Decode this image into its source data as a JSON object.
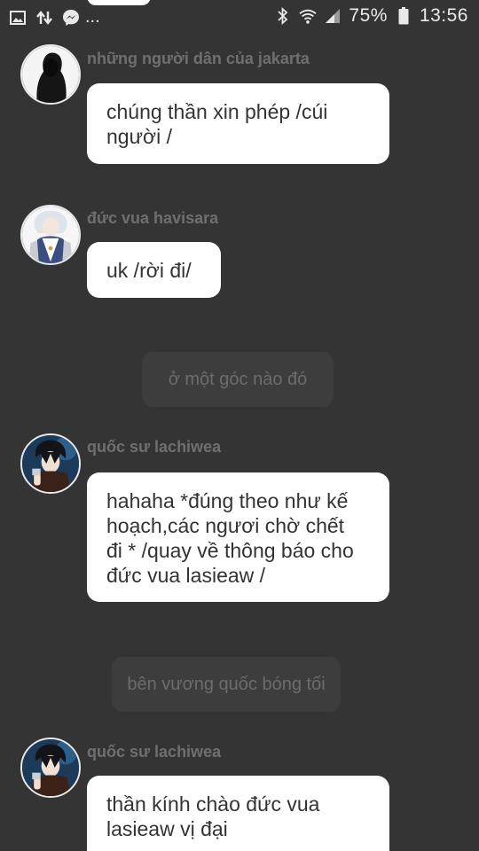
{
  "status_bar": {
    "battery_percent": "75%",
    "time": "13:56",
    "overflow": "...",
    "icons": [
      "gallery-icon",
      "data-transfer-icon",
      "messenger-icon",
      "bluetooth-icon",
      "wifi-icon",
      "signal-icon",
      "battery-icon"
    ]
  },
  "colors": {
    "background": "#343434",
    "bubble": "#ffffff",
    "bubble_text": "#333333",
    "sender_text": "#6f6f6f",
    "narration_bg": "#3d3d3d",
    "narration_text": "#6c6c6c"
  },
  "messages": [
    {
      "sender": "những người dân của jakarta",
      "lines": [
        "chúng thần xin phép /cúi",
        "người /"
      ],
      "avatar": "silhouette-avatar"
    },
    {
      "sender": "đức vua havisara",
      "lines": [
        "uk /rời đi/"
      ],
      "avatar": "king-avatar"
    },
    {
      "sender": "quốc sư lachiwea",
      "lines": [
        "hahaha *đúng theo như kế",
        "hoạch,các ngươi chờ chết",
        "đi * /quay về thông báo cho",
        "đức vua lasieaw /"
      ],
      "avatar": "advisor-avatar"
    },
    {
      "sender": "quốc sư lachiwea",
      "lines": [
        "thần kính chào đức vua",
        "lasieaw vị đại"
      ],
      "avatar": "advisor-avatar"
    }
  ],
  "narrations": [
    "ở một góc nào đó",
    "bên vương quốc bóng tối"
  ]
}
